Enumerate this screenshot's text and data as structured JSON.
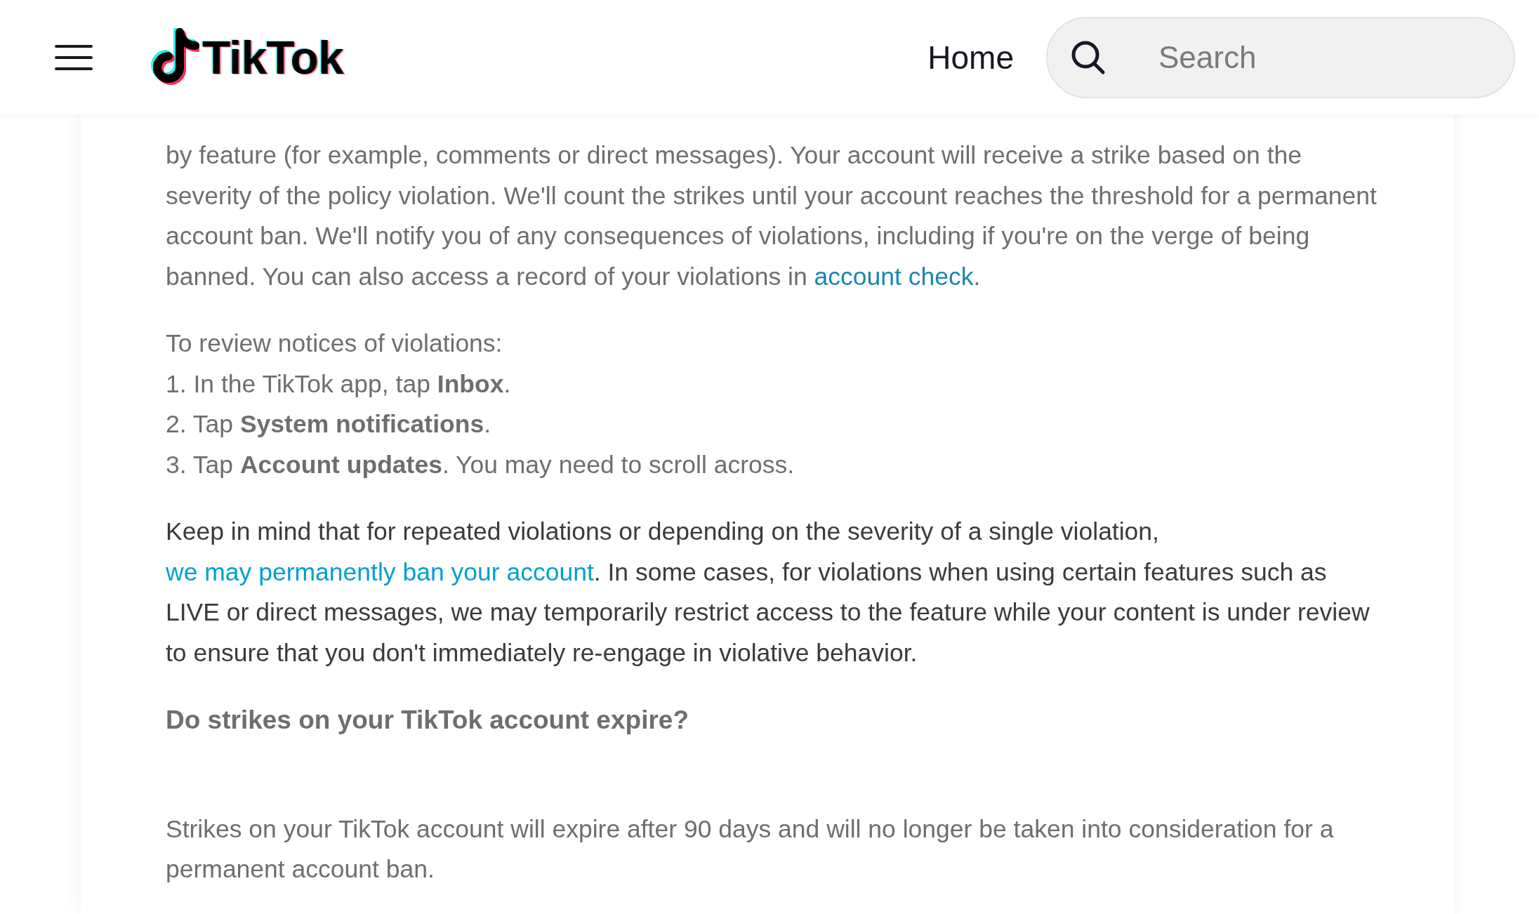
{
  "header": {
    "logo": "TikTok",
    "nav": [
      {
        "label": "Home"
      }
    ],
    "search": {
      "placeholder": "Search"
    }
  },
  "content": [
    {
      "kind": "paragraph",
      "blurred": true,
      "parts": [
        {
          "kind": "text",
          "text": "by feature (for example, comments or direct messages). Your account will receive a strike based on the severity of the policy violation. We'll count the strikes until your account reaches the threshold for a permanent account ban. We'll notify you of any consequences of violations, including if you're on the verge of being banned. You can also access a record of your violations in "
        },
        {
          "kind": "link",
          "text": "account check"
        },
        {
          "kind": "text",
          "text": "."
        }
      ]
    },
    {
      "kind": "steps",
      "blurred": true,
      "lines": [
        "To review notices of violations:",
        "1. In the TikTok app, tap **Inbox**.",
        "2. Tap **System notifications**.",
        "3. Tap **Account updates**. You may need to scroll across."
      ]
    },
    {
      "kind": "paragraph",
      "blurred": false,
      "parts": [
        {
          "kind": "text",
          "text": "Keep in mind that for repeated violations or depending on the severity of a single violation, "
        },
        {
          "kind": "link",
          "text": "we may permanently ban your account"
        },
        {
          "kind": "text",
          "text": ". In some cases, for violations when using certain features such as LIVE or direct messages, we may temporarily restrict access to the feature while your content is under review to ensure that you don't immediately re-engage in violative behavior."
        }
      ]
    },
    {
      "kind": "heading",
      "blurred": true,
      "text": "Do strikes on your TikTok account expire?"
    },
    {
      "kind": "paragraph",
      "blurred": true,
      "parts": [
        {
          "kind": "text",
          "text": "Strikes on your TikTok account will expire after 90 days and will no longer be taken into consideration for a permanent account ban."
        }
      ]
    }
  ]
}
